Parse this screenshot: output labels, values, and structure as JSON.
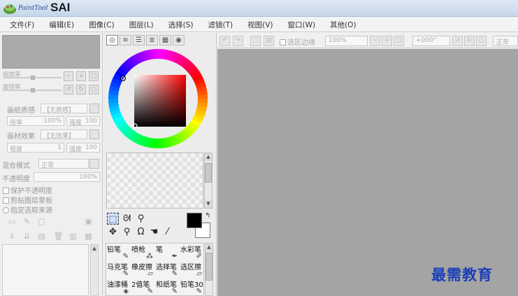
{
  "app": {
    "logo_small_text": "PaintTool",
    "logo_big_text": "SAI"
  },
  "menu": [
    {
      "label": "文件(F)"
    },
    {
      "label": "编辑(E)"
    },
    {
      "label": "图像(C)"
    },
    {
      "label": "图层(L)"
    },
    {
      "label": "选择(S)"
    },
    {
      "label": "滤镜(T)"
    },
    {
      "label": "视图(V)"
    },
    {
      "label": "窗口(W)"
    },
    {
      "label": "其他(O)"
    }
  ],
  "left_panel": {
    "zoom_label": "缩放率",
    "rotate_label": "旋转率",
    "paper_texture_label": "画纸质感",
    "paper_texture_value": "【无质感】",
    "scale_label": "倍率",
    "scale_value": "100%",
    "strength_label": "强度",
    "strength_value": "100",
    "paper_effect_label": "画材效果",
    "paper_effect_value": "【无效果】",
    "degree_label": "程度",
    "degree_value": "1",
    "strength2_label": "强度",
    "strength2_value": "100",
    "blend_mode_label": "混合模式",
    "blend_mode_value": "正常",
    "opacity_label": "不透明度",
    "opacity_value": "100%",
    "preserve_opacity_label": "保护不透明度",
    "clipping_label": "剪贴图层蒙板",
    "selection_source_label": "指定选取来源"
  },
  "tool_panel": {
    "brushes": [
      {
        "label": "铅笔",
        "icon": "pencil-icon"
      },
      {
        "label": "喷枪",
        "icon": "airbrush-icon"
      },
      {
        "label": "笔",
        "icon": "pen-icon"
      },
      {
        "label": "水彩笔",
        "icon": "watercolor-icon"
      },
      {
        "label": "马克笔",
        "icon": "marker-icon"
      },
      {
        "label": "橡皮擦",
        "icon": "eraser-icon"
      },
      {
        "label": "选择笔",
        "icon": "select-pen-icon"
      },
      {
        "label": "选区擦",
        "icon": "select-eraser-icon"
      },
      {
        "label": "油漆桶",
        "icon": "bucket-icon"
      },
      {
        "label": "2值笔",
        "icon": "binary-pen-icon"
      },
      {
        "label": "和纸笔",
        "icon": "washi-pen-icon"
      },
      {
        "label": "铅笔30",
        "icon": "pencil30-icon"
      }
    ]
  },
  "canvas_toolbar": {
    "selection_edge_label": "选区边缘",
    "zoom_value": "100%",
    "rotation_value": "+000°",
    "blend_value": "正常"
  },
  "watermark": "最需教育",
  "colors": {
    "canvas_bg": "#a4a4a4",
    "foreground": "#000000",
    "background": "#ffffff",
    "hue_selected": "#ff0000",
    "watermark": "#1b3fb8"
  }
}
